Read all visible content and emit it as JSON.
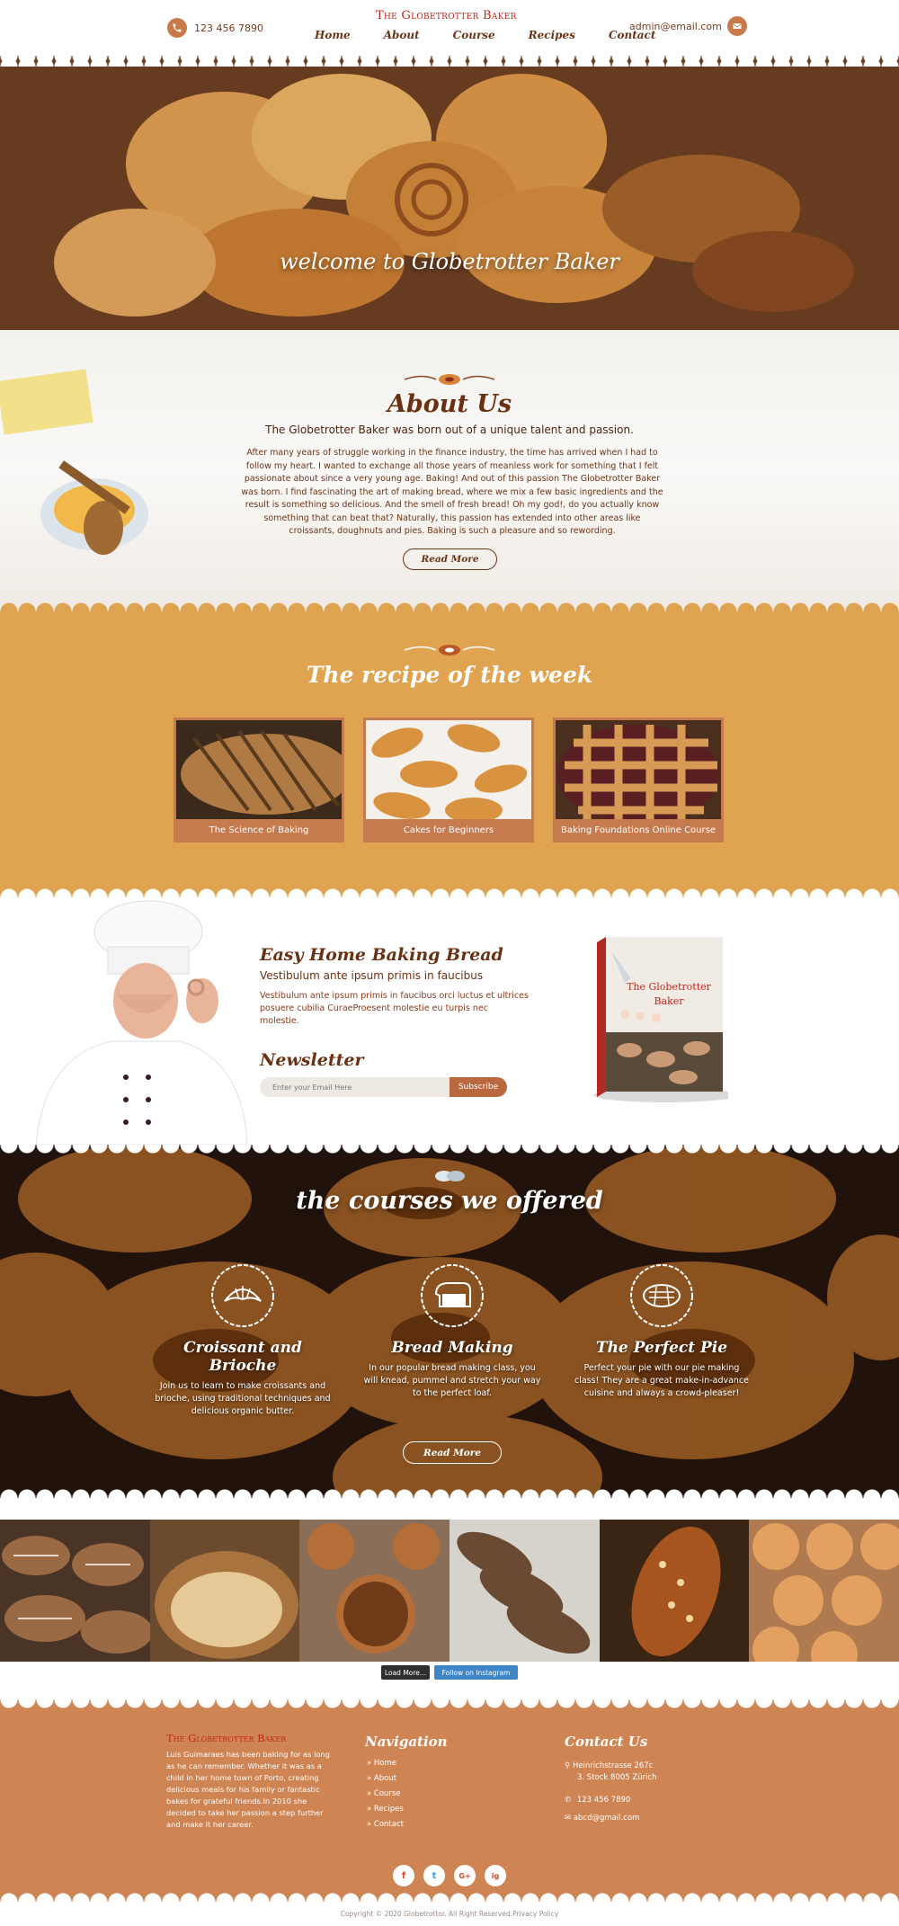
{
  "header": {
    "phone": "123 456 7890",
    "logo": "The Globetrotter Baker",
    "nav": [
      "Home",
      "About",
      "Course",
      "Recipes",
      "Contact"
    ],
    "email": "admin@email.com"
  },
  "hero": {
    "title": "welcome to Globetrotter Baker"
  },
  "about": {
    "title": "About Us",
    "subtitle": "The Globetrotter Baker was born out of a unique talent and passion.",
    "body": "After many years of struggle working in the finance industry, the time has arrived when I had to follow my heart. I wanted to exchange all those years of meanless work for something that I felt passionate about since a very young age. Baking! And out of this passion The Globetrotter Baker was born. I find fascinating the art of making bread, where we mix a few basic ingredients and the result is something so delicious. And the smell of fresh bread! Oh my god!, do you actually know something that can beat that? Naturally, this passion has extended into other areas like croissants, doughnuts and pies. Baking is such a pleasure and so rewording.",
    "button": "Read More"
  },
  "recipe": {
    "title": "The recipe of the week",
    "cards": [
      {
        "caption": "The Science of Baking"
      },
      {
        "caption": "Cakes for Beginners"
      },
      {
        "caption": "Baking Foundations Online Course"
      }
    ]
  },
  "ebook": {
    "title": "Easy Home Baking Bread",
    "subtitle": "Vestibulum ante ipsum primis in faucibus",
    "body": "Vestibulum ante ipsum primis in faucibus orci luctus et ultrices posuere cubilia CuraeProesent molestie eu turpis nec molestie.",
    "book_title": "The Globetrotter Baker"
  },
  "newsletter": {
    "title": "Newsletter",
    "placeholder": "Enter your Email Here",
    "button": "Subscribe"
  },
  "courses": {
    "title": "the courses we offered",
    "items": [
      {
        "title": "Croissant and Brioche",
        "desc": "Join us to learn to make croissants and brioche, using traditional techniques and delicious organic butter.",
        "icon": "croissant-icon"
      },
      {
        "title": "Bread Making",
        "desc": "In our popular bread making class, you will knead, pummel and stretch your way to the perfect loaf.",
        "icon": "bread-icon"
      },
      {
        "title": "The Perfect Pie",
        "desc": "Perfect your pie with our pie making class! They are a great make-in-advance cuisine and always a crowd-pleaser!",
        "icon": "pie-icon"
      }
    ],
    "button": "Read More"
  },
  "gallery": {
    "load_more": "Load More...",
    "follow": "Follow on Instagram"
  },
  "footer": {
    "logo": "The Globetrotter Baker",
    "bio": "Luis Guimaraes has been baking for as long as he can remember. Whether it was as a child in her home town of Porto, creating delicious meals for his family or fantastic bakes for grateful friends.In 2010 she decided to take her passion a step further and make it her career.",
    "nav_title": "Navigation",
    "links": [
      "Home",
      "About",
      "Course",
      "Recipes",
      "Contact"
    ],
    "contact_title": "Contact Us",
    "address_1": "Heinrichstrasse 267c",
    "address_2": "3. Stock 8005 Zürich",
    "phone": "123 456 7890",
    "email": "abcd@gmail.com",
    "socials": [
      "f",
      "t",
      "G+",
      "ig"
    ]
  },
  "copyright": "Copyright © 2020 Globetrottor. All Right Reserved.Privacy Policy",
  "colors": {
    "brown": "#6b2f12",
    "orange": "#e0a34f",
    "footer": "#cf8453",
    "red": "#c0271b"
  }
}
